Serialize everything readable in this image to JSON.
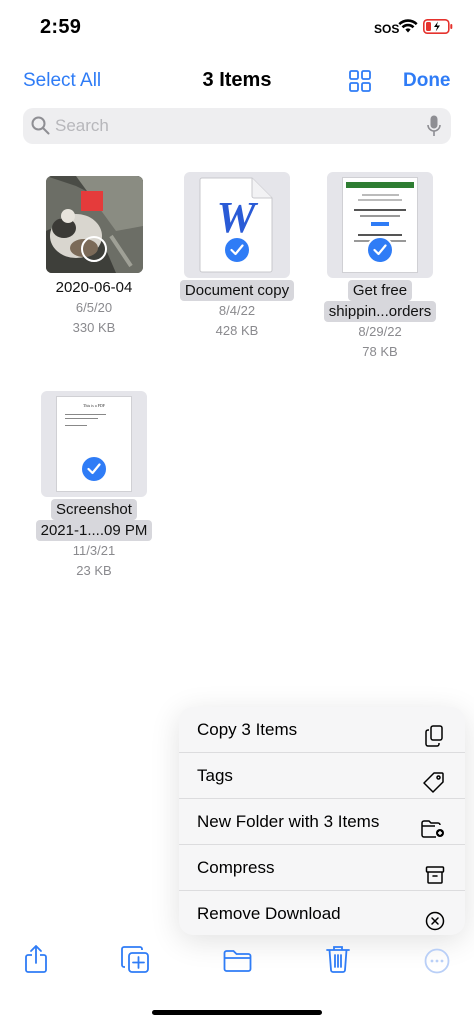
{
  "status": {
    "time": "2:59",
    "sos": "SOS"
  },
  "nav": {
    "select_all": "Select All",
    "title": "3 Items",
    "done": "Done"
  },
  "search": {
    "placeholder": "Search"
  },
  "files": [
    {
      "name": "2020-06-04",
      "date": "6/5/20",
      "size": "330 KB",
      "selected": false
    },
    {
      "name": "Document copy",
      "date": "8/4/22",
      "size": "428 KB",
      "selected": true
    },
    {
      "name_line1": "Get free",
      "name_line2": "shippin...orders",
      "date": "8/29/22",
      "size": "78 KB",
      "selected": true
    },
    {
      "name_line1": "Screenshot",
      "name_line2": "2021-1....09 PM",
      "date": "11/3/21",
      "size": "23 KB",
      "selected": true
    }
  ],
  "pdf_thumb_text": "This is a PDF",
  "menu": {
    "items": [
      {
        "label": "Copy 3 Items",
        "icon": "copy-icon"
      },
      {
        "label": "Tags",
        "icon": "tag-icon"
      },
      {
        "label": "New Folder with 3 Items",
        "icon": "folder-plus-icon"
      },
      {
        "label": "Compress",
        "icon": "archive-icon"
      },
      {
        "label": "Remove Download",
        "icon": "x-circle-icon"
      }
    ]
  },
  "colors": {
    "accent": "#2f7cf6",
    "battery_low": "#e5322d",
    "word_blue": "#2a5bd6"
  }
}
